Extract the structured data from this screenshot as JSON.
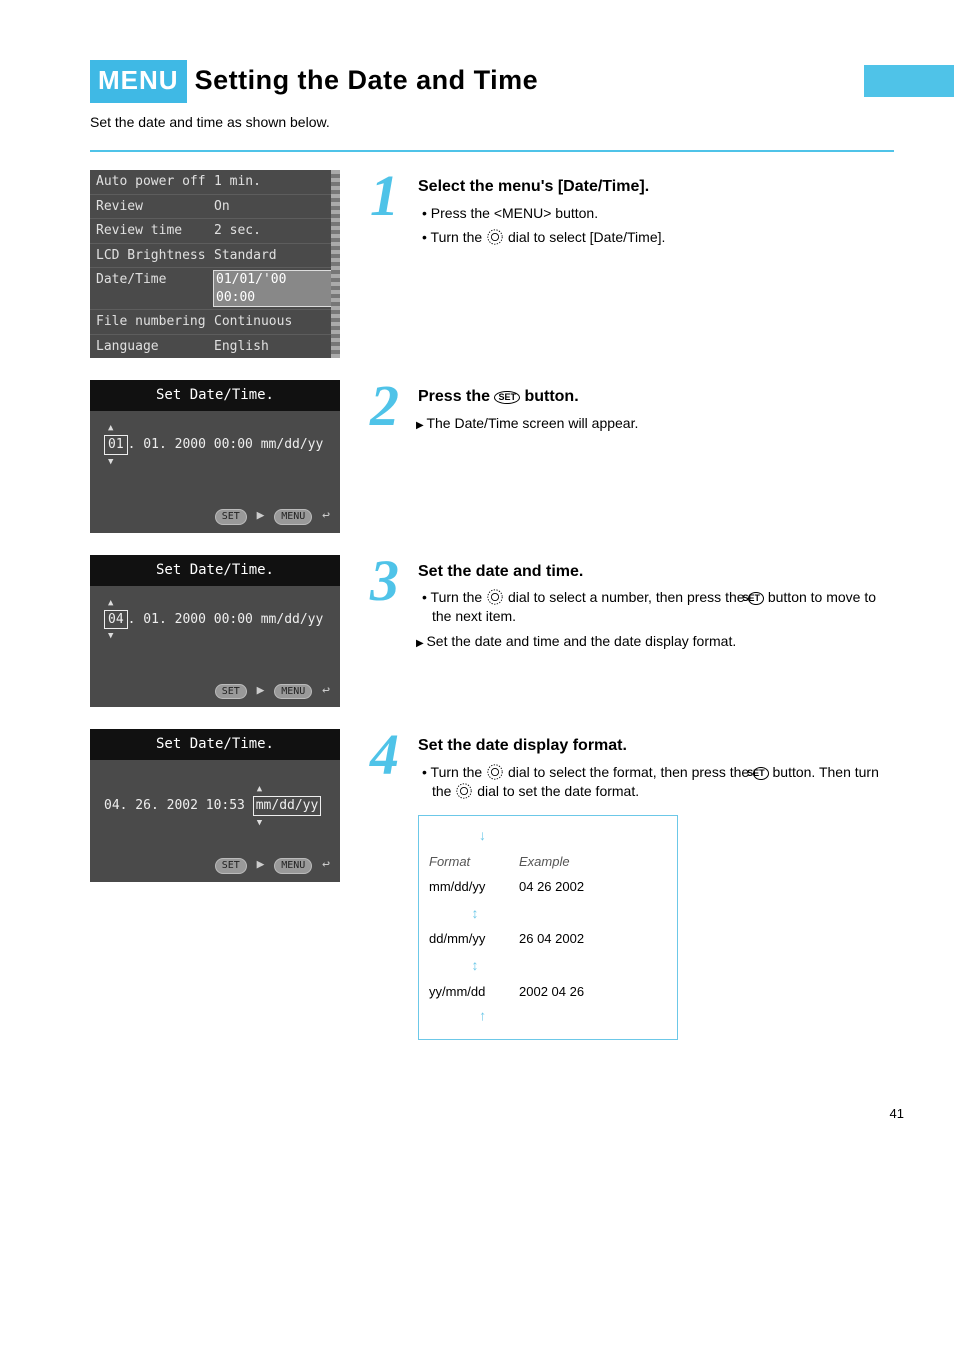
{
  "header": {
    "menu_badge": "MENU",
    "title": "Setting the Date and Time",
    "intro": "Set the date and time as shown below.",
    "page_number": "41"
  },
  "menu_screen": {
    "rows": [
      {
        "k": "Auto power off",
        "v": "1 min."
      },
      {
        "k": "Review",
        "v": "On"
      },
      {
        "k": "Review time",
        "v": "2 sec."
      },
      {
        "k": "LCD Brightness",
        "v": "Standard"
      },
      {
        "k": "Date/Time",
        "v": "01/01/'00 00:00",
        "selected": true
      },
      {
        "k": "File numbering",
        "v": "Continuous"
      },
      {
        "k": "Language",
        "v": "English"
      }
    ]
  },
  "datetime_screens": [
    {
      "title": "Set Date/Time.",
      "value_pre": "",
      "value_box": "01",
      "value_post": ". 01. 2000  00:00  mm/dd/yy",
      "footleft": "SET",
      "footmid": "▶",
      "footright": "MENU",
      "footret": "↩"
    },
    {
      "title": "Set Date/Time.",
      "value_pre": "",
      "value_box": "04",
      "value_post": ". 01. 2000  00:00  mm/dd/yy",
      "footleft": "SET",
      "footmid": "▶",
      "footright": "MENU",
      "footret": "↩"
    },
    {
      "title": "Set Date/Time.",
      "value_plain": "04. 26. 2002  10:53 ",
      "value_endbox": "mm/dd/yy",
      "footleft": "SET",
      "footmid": "▶",
      "footright": "MENU",
      "footret": "↩"
    }
  ],
  "steps": [
    {
      "num": "1",
      "main": "Select the menu's [Date/Time].",
      "subs": [
        "Press the <MENU> button.",
        "Turn the      dial to select [Date/Time]."
      ],
      "dial_after_text": "Turn the ",
      "dial_tail": " dial to select [Date/Time]."
    },
    {
      "num": "2",
      "main_pre": "Press the ",
      "main_set": "SET",
      "main_post": " button.",
      "results": [
        "The Date/Time screen will appear."
      ]
    },
    {
      "num": "3",
      "main": "Set the date and time.",
      "subs_dial": "Turn the ",
      "subs_dial_tail": " dial to select a number, then press the ",
      "subs_set": "SET",
      "subs_dial_end": " button to move to the next item.",
      "results": [
        "Set the date and time and the date display format."
      ]
    },
    {
      "num": "4",
      "main": "Set the date display format.",
      "sub4a_pre": "Turn the ",
      "sub4a_post": " dial to select the format, then press the ",
      "sub4a_set": "SET",
      "sub4a_end": " button. Then turn the ",
      "sub4a_end2": " dial to set the date format.",
      "formatbox": {
        "heading_label": "Format",
        "heading_example": "Example",
        "rows": [
          {
            "fmt": "mm/dd/yy",
            "ex": "04 26 2002"
          },
          {
            "fmt": "dd/mm/yy",
            "ex": "26 04 2002"
          },
          {
            "fmt": "yy/mm/dd",
            "ex": "2002 04 26"
          }
        ]
      }
    }
  ]
}
